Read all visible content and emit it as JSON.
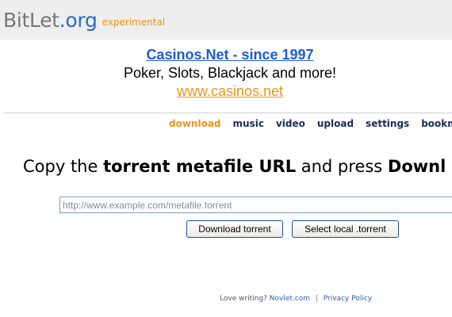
{
  "header": {
    "logo_bit": "BitLet",
    "logo_org": ".org",
    "logo_tag": "experimental"
  },
  "ad": {
    "title": "Casinos.Net - since 1997",
    "description": "Poker, Slots, Blackjack and more!",
    "link": "www.casinos.net"
  },
  "nav": {
    "items": [
      {
        "label": "download",
        "active": true
      },
      {
        "label": "music"
      },
      {
        "label": "video"
      },
      {
        "label": "upload"
      },
      {
        "label": "settings"
      },
      {
        "label": "bookm"
      }
    ]
  },
  "main": {
    "headline_prefix": "Copy the ",
    "headline_bold1": "torrent metafile URL",
    "headline_middle": " and press ",
    "headline_bold2": "Downl",
    "url_placeholder": "http://www.example.com/metafile.torrent",
    "download_button": "Download torrent",
    "local_button": "Select local .torrent"
  },
  "footer": {
    "prefix": "Love writing?",
    "novlet_link": "Novlet.com",
    "separator": "|",
    "privacy_link": "Privacy Policy"
  },
  "colors": {
    "accent_orange": "#e8941f",
    "link_blue": "#1f5bd6",
    "header_bg": "#eeeeee"
  }
}
